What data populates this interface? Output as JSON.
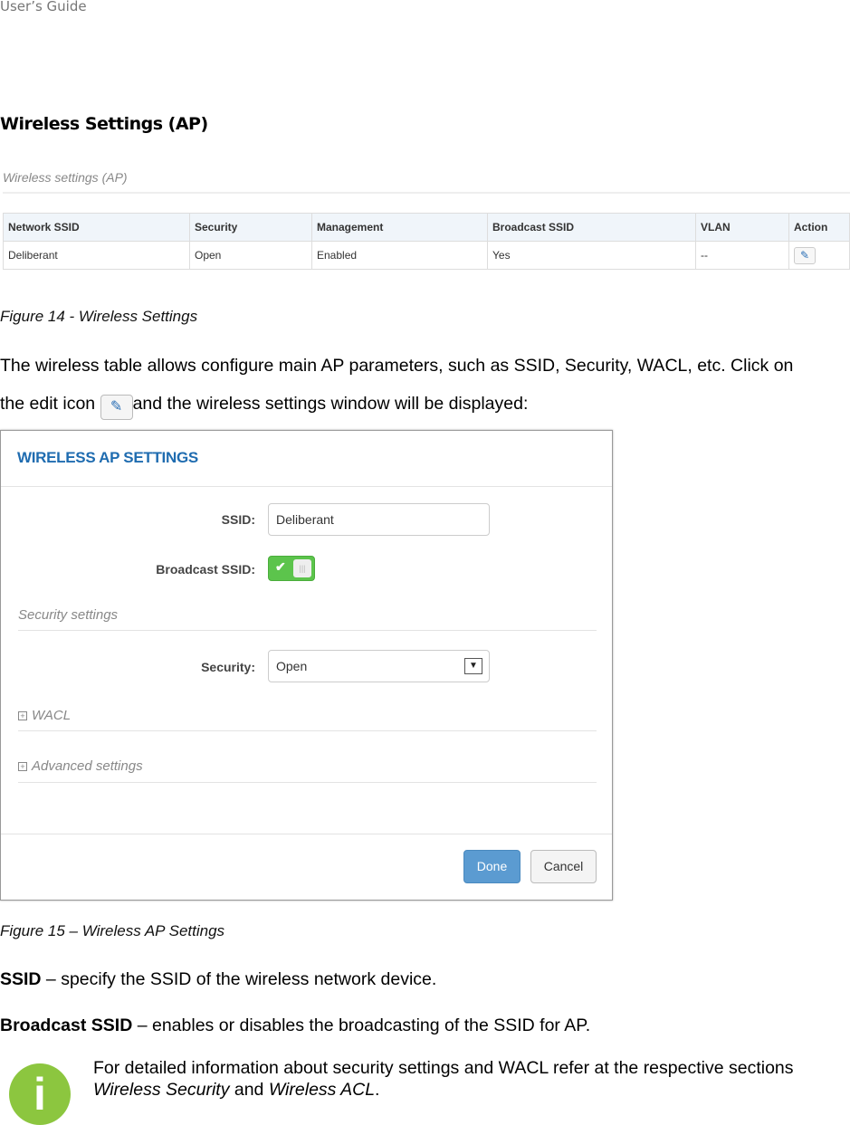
{
  "header": "User’s Guide",
  "heading": "Wireless Settings (AP)",
  "fig14": {
    "section_title": "Wireless settings (AP)",
    "columns": [
      "Network SSID",
      "Security",
      "Management",
      "Broadcast SSID",
      "VLAN",
      "Action"
    ],
    "rows": [
      {
        "ssid": "Deliberant",
        "security": "Open",
        "management": "Enabled",
        "broadcast": "Yes",
        "vlan": "--",
        "action_icon": "pencil-icon"
      }
    ],
    "caption": "Figure 14 - Wireless Settings"
  },
  "para1": {
    "line1": "The wireless table allows configure main AP parameters, such as SSID, Security, WACL, etc. Click on",
    "pre": "the edit icon ",
    "post": "and the wireless settings window will be displayed:"
  },
  "dialog": {
    "title": "WIRELESS AP SETTINGS",
    "ssid_label": "SSID:",
    "ssid_value": "Deliberant",
    "broadcast_label": "Broadcast SSID:",
    "broadcast_on": true,
    "security_section": "Security settings",
    "security_label": "Security:",
    "security_value": "Open",
    "wacl": "WACL",
    "advanced": "Advanced settings",
    "done": "Done",
    "cancel": "Cancel",
    "accent": "#1f6cb0",
    "toggle_color": "#5cc44c"
  },
  "fig15_caption": "Figure 15 – Wireless AP Settings",
  "defs": [
    {
      "term": "SSID",
      "text": " – specify the SSID of the wireless network device."
    },
    {
      "term": "Broadcast SSID",
      "text": " – enables or disables the broadcasting of the SSID for AP."
    }
  ],
  "note": {
    "icon": "info-icon",
    "pre": "For detailed information about security settings and WACL refer at the respective sections ",
    "link1": "Wireless Security",
    "mid": " and ",
    "link2": "Wireless ACL",
    "end": "."
  }
}
